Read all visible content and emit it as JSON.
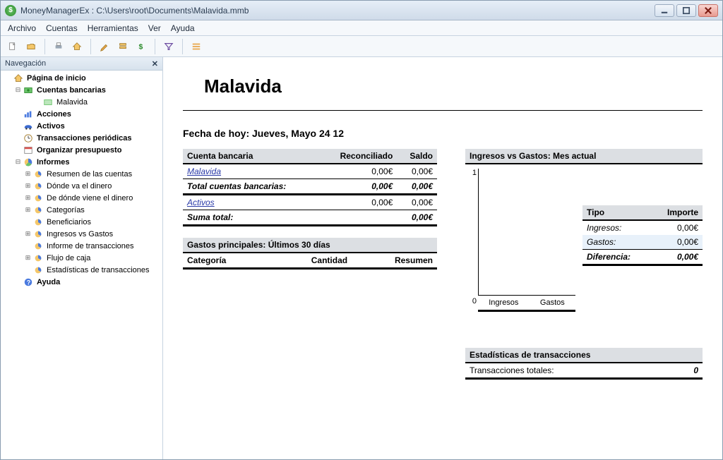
{
  "window": {
    "title": "MoneyManagerEx : C:\\Users\\root\\Documents\\Malavida.mmb",
    "icon_char": "$"
  },
  "menu": {
    "items": [
      "Archivo",
      "Cuentas",
      "Herramientas",
      "Ver",
      "Ayuda"
    ]
  },
  "toolbar": {
    "icons": [
      "new-file-icon",
      "open-file-icon",
      "print-icon",
      "home-icon",
      "edit-account-icon",
      "account-list-icon",
      "currency-icon",
      "filter-icon",
      "options-icon"
    ]
  },
  "nav": {
    "header": "Navegación",
    "root": {
      "label": "Página de inicio",
      "children": [
        {
          "label": "Cuentas bancarias",
          "expanded": true,
          "children": [
            {
              "label": "Malavida"
            }
          ]
        },
        {
          "label": "Acciones"
        },
        {
          "label": "Activos"
        },
        {
          "label": "Transacciones periódicas"
        },
        {
          "label": "Organizar presupuesto"
        },
        {
          "label": "Informes",
          "expanded": true,
          "children": [
            {
              "label": "Resumen de las cuentas",
              "expandable": true
            },
            {
              "label": "Dónde va el dinero",
              "expandable": true
            },
            {
              "label": "De dónde viene el dinero",
              "expandable": true
            },
            {
              "label": "Categorías",
              "expandable": true
            },
            {
              "label": "Beneficiarios"
            },
            {
              "label": "Ingresos vs Gastos",
              "expandable": true
            },
            {
              "label": "Informe de transacciones"
            },
            {
              "label": "Flujo de caja",
              "expandable": true
            },
            {
              "label": "Estadísticas de transacciones"
            }
          ]
        },
        {
          "label": "Ayuda"
        }
      ]
    }
  },
  "page": {
    "title": "Malavida",
    "date_label": "Fecha de hoy: Jueves, Mayo 24 12"
  },
  "accounts_table": {
    "headers": [
      "Cuenta bancaria",
      "Reconciliado",
      "Saldo"
    ],
    "rows": [
      {
        "name": "Malavida",
        "reconciled": "0,00€",
        "balance": "0,00€",
        "link": true
      }
    ],
    "total_label": "Total cuentas bancarias:",
    "total_reconciled": "0,00€",
    "total_balance": "0,00€",
    "assets_label": "Activos",
    "assets_reconciled": "0,00€",
    "assets_balance": "0,00€",
    "sum_label": "Suma total:",
    "sum_value": "0,00€"
  },
  "top_expenses": {
    "title": "Gastos principales: Últimos 30 días",
    "headers": [
      "Categoría",
      "Cantidad",
      "Resumen"
    ]
  },
  "chart": {
    "title": "Ingresos vs Gastos: Mes actual",
    "y_top": "1",
    "y_bottom": "0",
    "x_labels": [
      "Ingresos",
      "Gastos"
    ]
  },
  "summary_table": {
    "headers": [
      "Tipo",
      "Importe"
    ],
    "rows": [
      {
        "label": "Ingresos:",
        "value": "0,00€"
      },
      {
        "label": "Gastos:",
        "value": "0,00€"
      }
    ],
    "diff_label": "Diferencia:",
    "diff_value": "0,00€"
  },
  "stats": {
    "title": "Estadísticas de transacciones",
    "row_label": "Transacciones totales:",
    "row_value": "0"
  },
  "chart_data": {
    "type": "bar",
    "categories": [
      "Ingresos",
      "Gastos"
    ],
    "values": [
      0,
      0
    ],
    "title": "Ingresos vs Gastos: Mes actual",
    "xlabel": "",
    "ylabel": "",
    "ylim": [
      0,
      1
    ]
  }
}
